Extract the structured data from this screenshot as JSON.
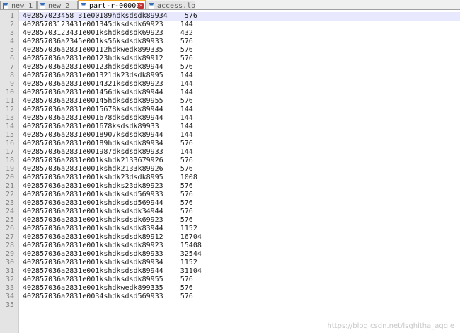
{
  "tabs": [
    {
      "label": "new 1",
      "active": false
    },
    {
      "label": "new 2",
      "active": false
    },
    {
      "label": "part-r-00000",
      "active": true
    },
    {
      "label": "access.log",
      "active": false
    }
  ],
  "lines": [
    {
      "n": "1",
      "text": "402857023458 31e00189hdksdsdk89934    576"
    },
    {
      "n": "2",
      "text": "40285703123431e001345dksdsdk69923    144"
    },
    {
      "n": "3",
      "text": "40285703123431e001kshdksdsdk69923    432"
    },
    {
      "n": "4",
      "text": "402857036a2345e001ks56ksdsdk89933    576"
    },
    {
      "n": "5",
      "text": "402857036a2831e00112hdkwedk899335    576"
    },
    {
      "n": "6",
      "text": "402857036a2831e00123hdksdsdk89912    576"
    },
    {
      "n": "7",
      "text": "402857036a2831e00123hdksdsdk89944    576"
    },
    {
      "n": "8",
      "text": "402857036a2831e001321dk23dsdk8995    144"
    },
    {
      "n": "9",
      "text": "402857036a2831e0014321ksdsdk89923    144"
    },
    {
      "n": "10",
      "text": "402857036a2831e001456dksdsdk89944    144"
    },
    {
      "n": "11",
      "text": "402857036a2831e00145hdksdsdk89955    576"
    },
    {
      "n": "12",
      "text": "402857036a2831e0015678ksdsdk89944    144"
    },
    {
      "n": "13",
      "text": "402857036a2831e001678dksdsdk89944    144"
    },
    {
      "n": "14",
      "text": "402857036a2831e001678ksdsdk89933     144"
    },
    {
      "n": "15",
      "text": "402857036a2831e0018907ksdsdk89944    144"
    },
    {
      "n": "16",
      "text": "402857036a2831e00189hdksdsdk89934    576"
    },
    {
      "n": "17",
      "text": "402857036a2831e001987dksdsdk89933    144"
    },
    {
      "n": "18",
      "text": "402857036a2831e001kshdk2133679926    576"
    },
    {
      "n": "19",
      "text": "402857036a2831e001kshdk2133k89926    576"
    },
    {
      "n": "20",
      "text": "402857036a2831e001kshdk23dsdk8995    1008"
    },
    {
      "n": "21",
      "text": "402857036a2831e001kshdks23dk89923    576"
    },
    {
      "n": "22",
      "text": "402857036a2831e001kshdksdsd569933    576"
    },
    {
      "n": "23",
      "text": "402857036a2831e001kshdksdsd569944    576"
    },
    {
      "n": "24",
      "text": "402857036a2831e001kshdksdsdk34944    576"
    },
    {
      "n": "25",
      "text": "402857036a2831e001kshdksdsdk69923    576"
    },
    {
      "n": "26",
      "text": "402857036a2831e001kshdksdsdk83944    1152"
    },
    {
      "n": "27",
      "text": "402857036a2831e001kshdksdsdk89912    16704"
    },
    {
      "n": "28",
      "text": "402857036a2831e001kshdksdsdk89923    15408"
    },
    {
      "n": "29",
      "text": "402857036a2831e001kshdksdsdk89933    32544"
    },
    {
      "n": "30",
      "text": "402857036a2831e001kshdksdsdk89934    1152"
    },
    {
      "n": "31",
      "text": "402857036a2831e001kshdksdsdk89944    31104"
    },
    {
      "n": "32",
      "text": "402857036a2831e001kshdksdsdk89955    576"
    },
    {
      "n": "33",
      "text": "402857036a2831e001kshdkwedk899335    576"
    },
    {
      "n": "34",
      "text": "402857036a2831e0034shdksdsd569933    576"
    },
    {
      "n": "35",
      "text": ""
    }
  ],
  "watermark": "https://blog.csdn.net/lsghitha_aggle"
}
